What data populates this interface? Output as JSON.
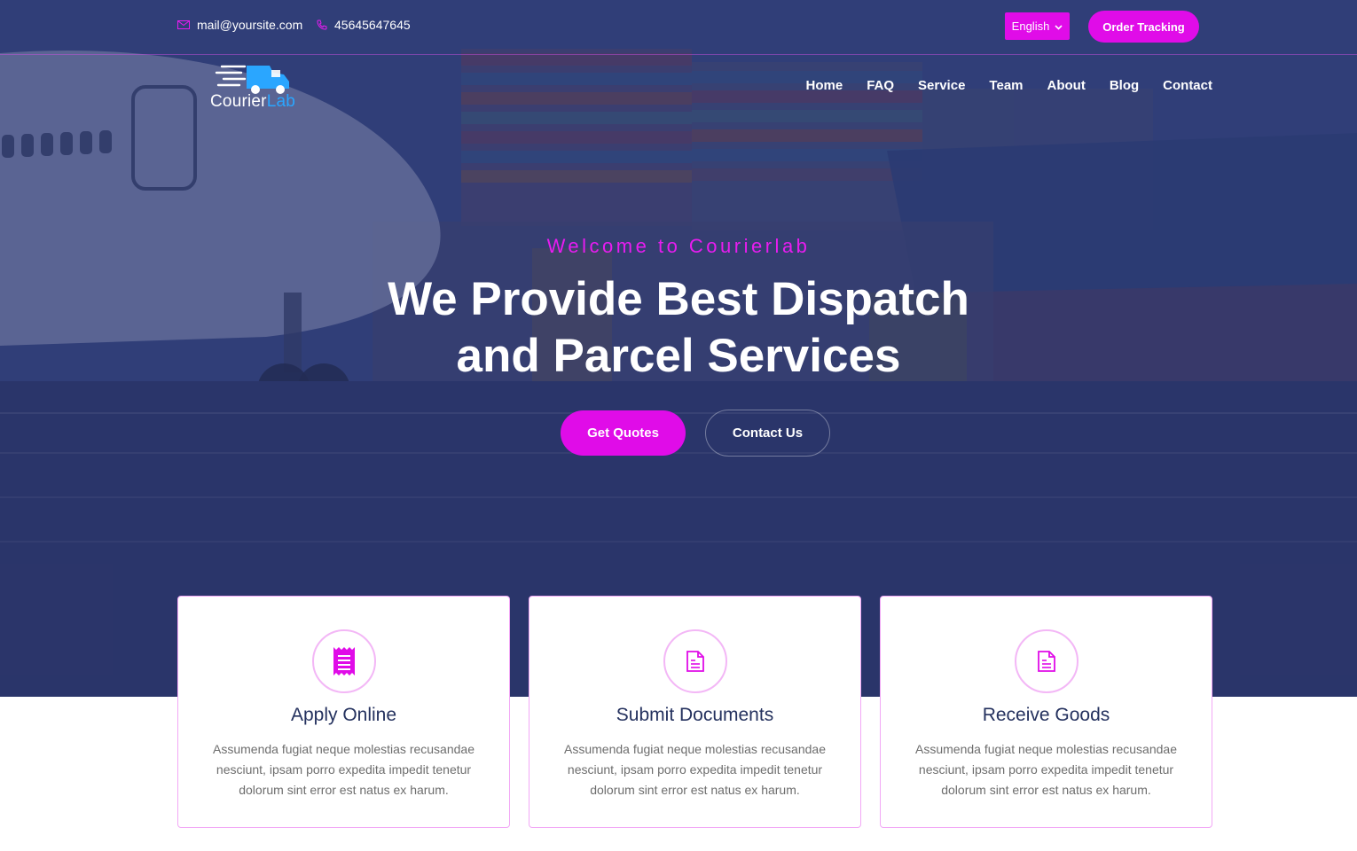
{
  "topbar": {
    "email": "mail@yoursite.com",
    "phone": "45645647645",
    "language": "English",
    "order_tracking": "Order Tracking"
  },
  "logo": {
    "part1": "Courier",
    "part2": "Lab"
  },
  "nav": [
    "Home",
    "FAQ",
    "Service",
    "Team",
    "About",
    "Blog",
    "Contact"
  ],
  "hero": {
    "welcome": "Welcome to Courierlab",
    "headline_line1": "We Provide Best Dispatch",
    "headline_line2": "and Parcel Services",
    "primary_button": "Get Quotes",
    "secondary_button": "Contact Us"
  },
  "features": [
    {
      "icon": "receipt-icon",
      "title": "Apply Online",
      "text": "Assumenda fugiat neque molestias recusandae nesciunt, ipsam porro expedita impedit tenetur dolorum sint error est natus ex harum."
    },
    {
      "icon": "document-icon",
      "title": "Submit Documents",
      "text": "Assumenda fugiat neque molestias recusandae nesciunt, ipsam porro expedita impedit tenetur dolorum sint error est natus ex harum."
    },
    {
      "icon": "document-icon",
      "title": "Receive Goods",
      "text": "Assumenda fugiat neque molestias recusandae nesciunt, ipsam porro expedita impedit tenetur dolorum sint error est natus ex harum."
    }
  ],
  "colors": {
    "accent": "#e00ce8",
    "hero_overlay": "#2c3a6e",
    "card_title": "#24315e",
    "logo_lab": "#2aa6ff"
  }
}
